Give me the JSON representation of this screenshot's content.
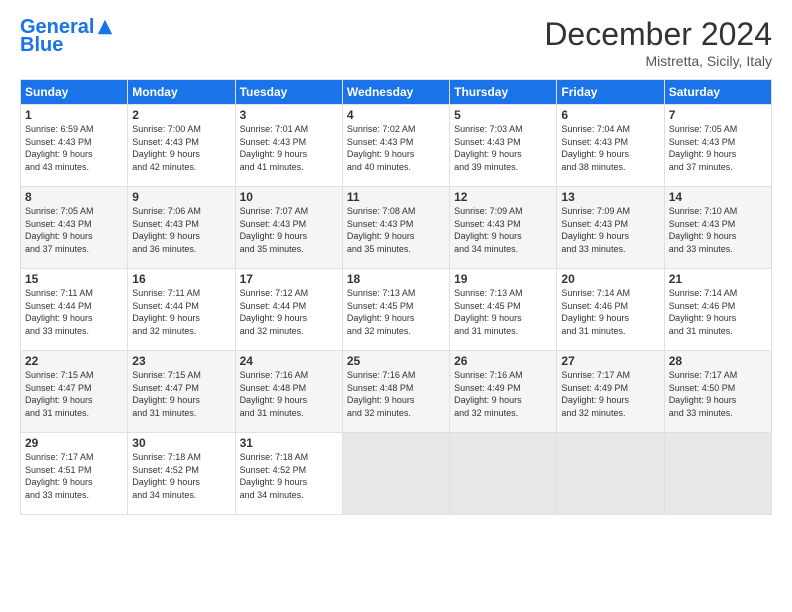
{
  "header": {
    "logo_line1": "General",
    "logo_line2": "Blue",
    "month_title": "December 2024",
    "location": "Mistretta, Sicily, Italy"
  },
  "weekdays": [
    "Sunday",
    "Monday",
    "Tuesday",
    "Wednesday",
    "Thursday",
    "Friday",
    "Saturday"
  ],
  "weeks": [
    [
      {
        "day": "1",
        "sunrise": "6:59 AM",
        "sunset": "4:43 PM",
        "daylight": "9 hours and 43 minutes."
      },
      {
        "day": "2",
        "sunrise": "7:00 AM",
        "sunset": "4:43 PM",
        "daylight": "9 hours and 42 minutes."
      },
      {
        "day": "3",
        "sunrise": "7:01 AM",
        "sunset": "4:43 PM",
        "daylight": "9 hours and 41 minutes."
      },
      {
        "day": "4",
        "sunrise": "7:02 AM",
        "sunset": "4:43 PM",
        "daylight": "9 hours and 40 minutes."
      },
      {
        "day": "5",
        "sunrise": "7:03 AM",
        "sunset": "4:43 PM",
        "daylight": "9 hours and 39 minutes."
      },
      {
        "day": "6",
        "sunrise": "7:04 AM",
        "sunset": "4:43 PM",
        "daylight": "9 hours and 38 minutes."
      },
      {
        "day": "7",
        "sunrise": "7:05 AM",
        "sunset": "4:43 PM",
        "daylight": "9 hours and 37 minutes."
      }
    ],
    [
      {
        "day": "8",
        "sunrise": "7:05 AM",
        "sunset": "4:43 PM",
        "daylight": "9 hours and 37 minutes."
      },
      {
        "day": "9",
        "sunrise": "7:06 AM",
        "sunset": "4:43 PM",
        "daylight": "9 hours and 36 minutes."
      },
      {
        "day": "10",
        "sunrise": "7:07 AM",
        "sunset": "4:43 PM",
        "daylight": "9 hours and 35 minutes."
      },
      {
        "day": "11",
        "sunrise": "7:08 AM",
        "sunset": "4:43 PM",
        "daylight": "9 hours and 35 minutes."
      },
      {
        "day": "12",
        "sunrise": "7:09 AM",
        "sunset": "4:43 PM",
        "daylight": "9 hours and 34 minutes."
      },
      {
        "day": "13",
        "sunrise": "7:09 AM",
        "sunset": "4:43 PM",
        "daylight": "9 hours and 33 minutes."
      },
      {
        "day": "14",
        "sunrise": "7:10 AM",
        "sunset": "4:43 PM",
        "daylight": "9 hours and 33 minutes."
      }
    ],
    [
      {
        "day": "15",
        "sunrise": "7:11 AM",
        "sunset": "4:44 PM",
        "daylight": "9 hours and 33 minutes."
      },
      {
        "day": "16",
        "sunrise": "7:11 AM",
        "sunset": "4:44 PM",
        "daylight": "9 hours and 32 minutes."
      },
      {
        "day": "17",
        "sunrise": "7:12 AM",
        "sunset": "4:44 PM",
        "daylight": "9 hours and 32 minutes."
      },
      {
        "day": "18",
        "sunrise": "7:13 AM",
        "sunset": "4:45 PM",
        "daylight": "9 hours and 32 minutes."
      },
      {
        "day": "19",
        "sunrise": "7:13 AM",
        "sunset": "4:45 PM",
        "daylight": "9 hours and 31 minutes."
      },
      {
        "day": "20",
        "sunrise": "7:14 AM",
        "sunset": "4:46 PM",
        "daylight": "9 hours and 31 minutes."
      },
      {
        "day": "21",
        "sunrise": "7:14 AM",
        "sunset": "4:46 PM",
        "daylight": "9 hours and 31 minutes."
      }
    ],
    [
      {
        "day": "22",
        "sunrise": "7:15 AM",
        "sunset": "4:47 PM",
        "daylight": "9 hours and 31 minutes."
      },
      {
        "day": "23",
        "sunrise": "7:15 AM",
        "sunset": "4:47 PM",
        "daylight": "9 hours and 31 minutes."
      },
      {
        "day": "24",
        "sunrise": "7:16 AM",
        "sunset": "4:48 PM",
        "daylight": "9 hours and 31 minutes."
      },
      {
        "day": "25",
        "sunrise": "7:16 AM",
        "sunset": "4:48 PM",
        "daylight": "9 hours and 32 minutes."
      },
      {
        "day": "26",
        "sunrise": "7:16 AM",
        "sunset": "4:49 PM",
        "daylight": "9 hours and 32 minutes."
      },
      {
        "day": "27",
        "sunrise": "7:17 AM",
        "sunset": "4:49 PM",
        "daylight": "9 hours and 32 minutes."
      },
      {
        "day": "28",
        "sunrise": "7:17 AM",
        "sunset": "4:50 PM",
        "daylight": "9 hours and 33 minutes."
      }
    ],
    [
      {
        "day": "29",
        "sunrise": "7:17 AM",
        "sunset": "4:51 PM",
        "daylight": "9 hours and 33 minutes."
      },
      {
        "day": "30",
        "sunrise": "7:18 AM",
        "sunset": "4:52 PM",
        "daylight": "9 hours and 34 minutes."
      },
      {
        "day": "31",
        "sunrise": "7:18 AM",
        "sunset": "4:52 PM",
        "daylight": "9 hours and 34 minutes."
      },
      null,
      null,
      null,
      null
    ]
  ],
  "labels": {
    "sunrise": "Sunrise:",
    "sunset": "Sunset:",
    "daylight": "Daylight:"
  }
}
